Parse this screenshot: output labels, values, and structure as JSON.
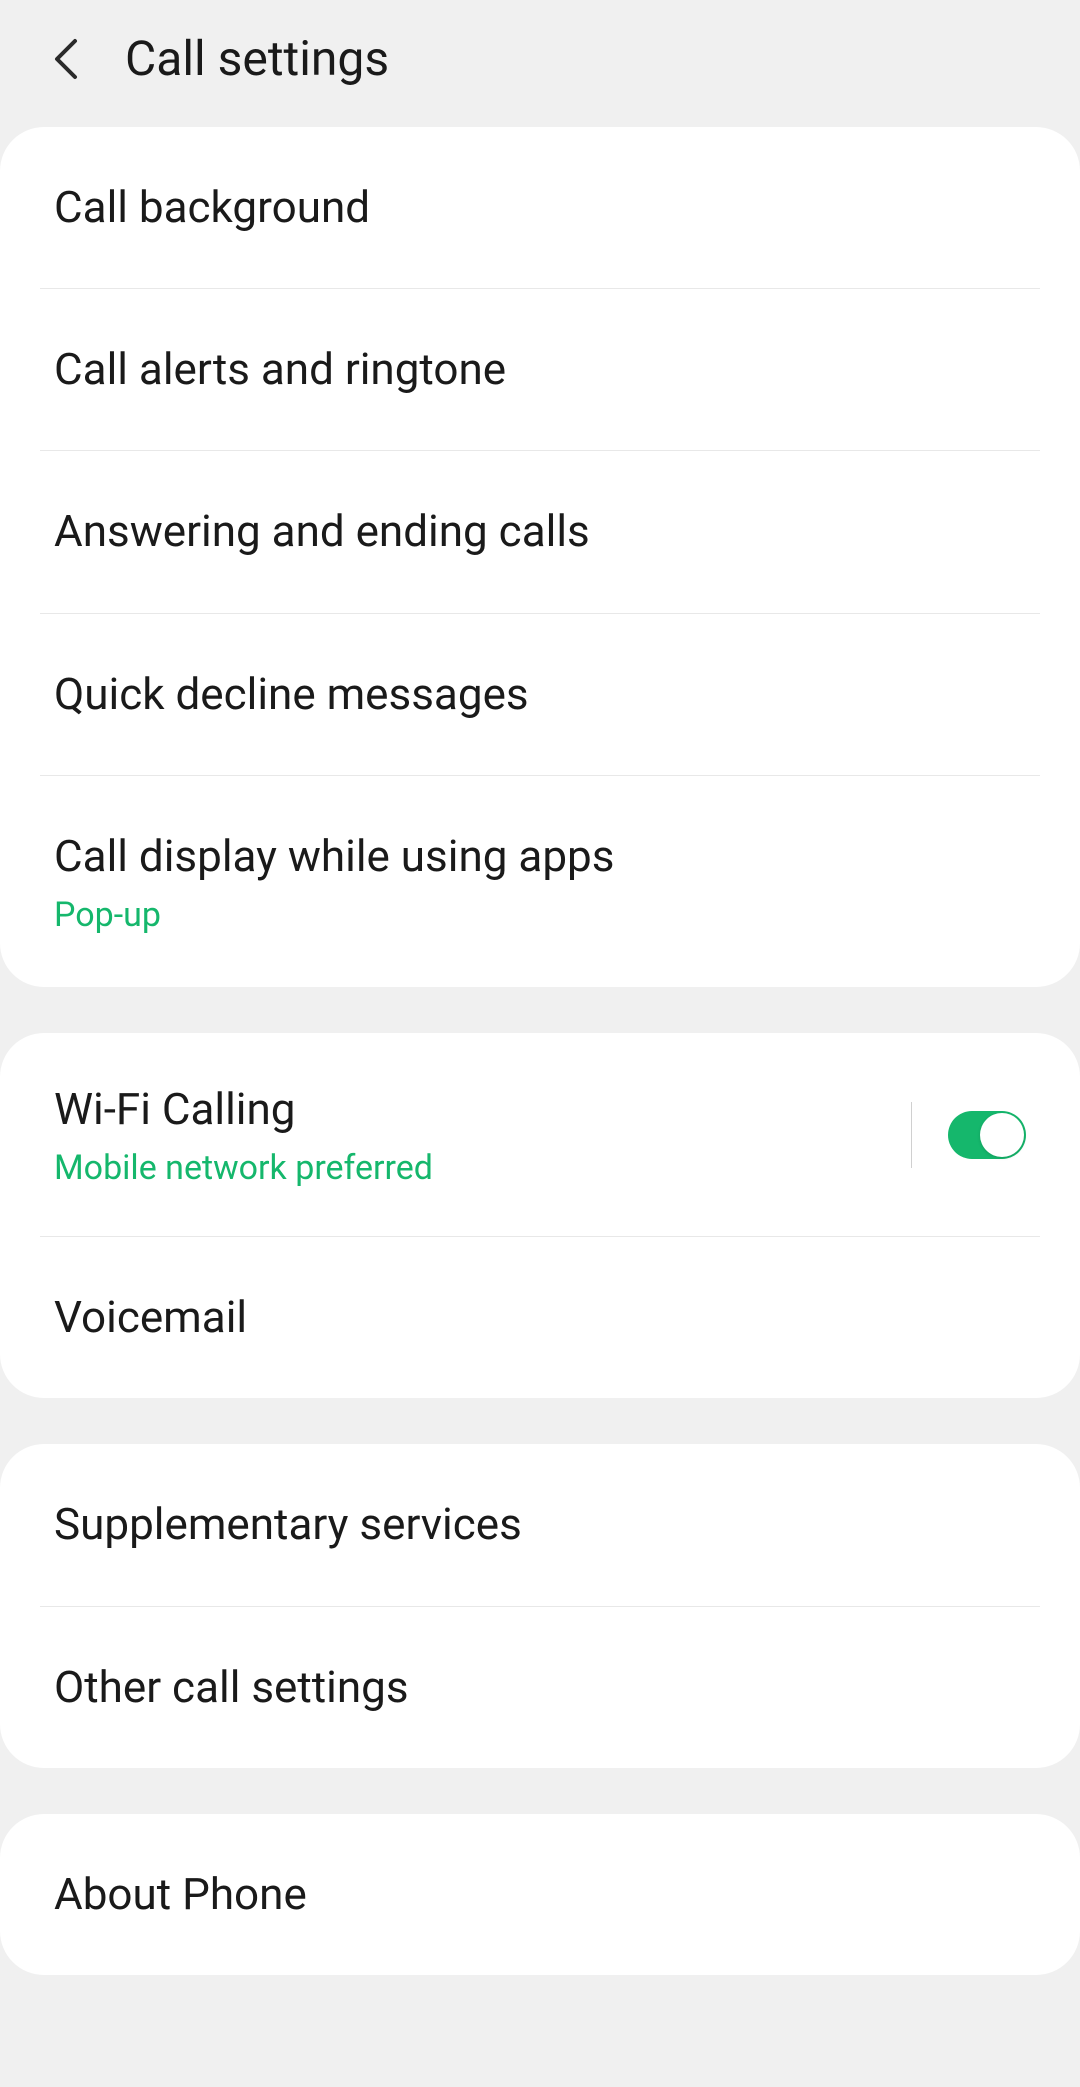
{
  "header": {
    "title": "Call settings"
  },
  "groups": [
    {
      "items": [
        {
          "title": "Call background"
        },
        {
          "title": "Call alerts and ringtone"
        },
        {
          "title": "Answering and ending calls"
        },
        {
          "title": "Quick decline messages"
        },
        {
          "title": "Call display while using apps",
          "subtitle": "Pop-up"
        }
      ]
    },
    {
      "items": [
        {
          "title": "Wi-Fi Calling",
          "subtitle": "Mobile network preferred",
          "toggle": true
        },
        {
          "title": "Voicemail"
        }
      ]
    },
    {
      "items": [
        {
          "title": "Supplementary services"
        },
        {
          "title": "Other call settings"
        }
      ]
    },
    {
      "items": [
        {
          "title": "About Phone"
        }
      ]
    }
  ]
}
